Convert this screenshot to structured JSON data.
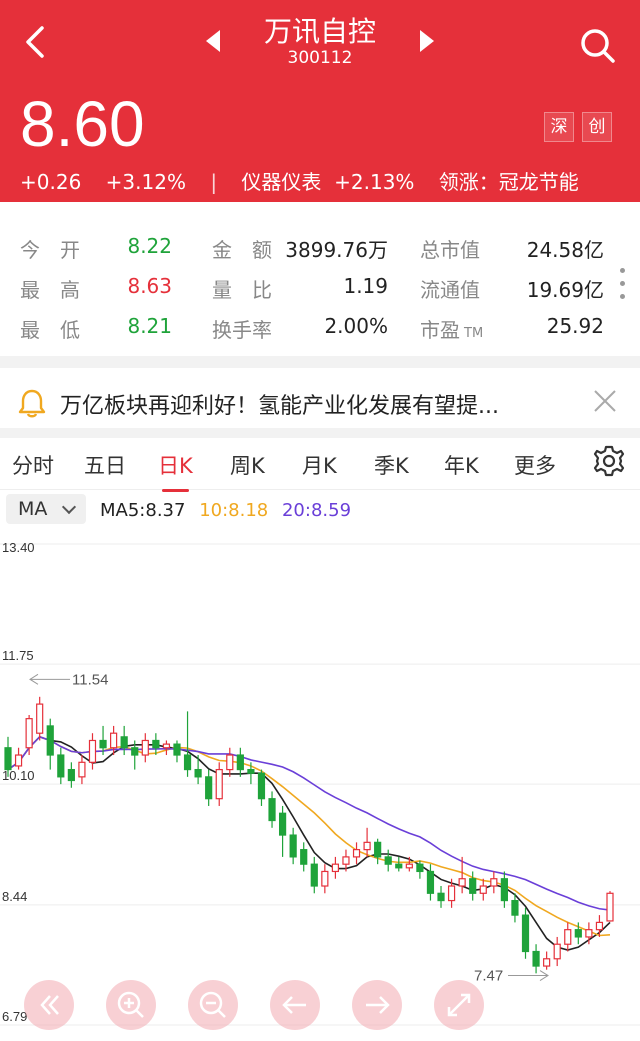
{
  "header": {
    "title": "万讯自控",
    "code": "300112",
    "price": "8.60",
    "change": "+0.26",
    "change_pct": "+3.12%",
    "separator": "|",
    "sector": "仪器仪表",
    "sector_change": "+2.13%",
    "leader": "领涨：冠龙节能",
    "tag_exchange": "深",
    "tag_board": "创"
  },
  "stats": {
    "open_label": "今　开",
    "open": "8.22",
    "high_label": "最　高",
    "high": "8.63",
    "low_label": "最　低",
    "low": "8.21",
    "amount_label": "金　额",
    "amount": "3899.76万",
    "volume_ratio_label": "量　比",
    "volume_ratio": "1.19",
    "turnover_label": "换手率",
    "turnover": "2.00%",
    "market_cap_label": "总市值",
    "market_cap": "24.58亿",
    "float_cap_label": "流通值",
    "float_cap": "19.69亿",
    "pe_label": "市盈",
    "pe_suffix": "TM",
    "pe": "25.92"
  },
  "news": {
    "text": "万亿板块再迎利好！氢能产业化发展有望提..."
  },
  "tabs": [
    {
      "label": "分时"
    },
    {
      "label": "五日"
    },
    {
      "label": "日K"
    },
    {
      "label": "周K"
    },
    {
      "label": "月K"
    },
    {
      "label": "季K"
    },
    {
      "label": "年K"
    },
    {
      "label": "更多"
    }
  ],
  "ma": {
    "selector": "MA",
    "ma5": "MA5:8.37",
    "ma10": "10:8.18",
    "ma20": "20:8.59"
  },
  "colors": {
    "up": "#e5303a",
    "down": "#1fa33a",
    "ma5": "#222222",
    "ma10": "#f0a820",
    "ma20": "#6a3fd8",
    "header_bg": "#e5303a"
  },
  "chart_data": {
    "type": "candlestick",
    "y_ticks": [
      "13.40",
      "11.75",
      "10.10",
      "8.44",
      "6.79"
    ],
    "ylim": [
      6.79,
      13.4
    ],
    "high_marker": "11.54",
    "low_marker": "7.47",
    "candles": [
      [
        10.6,
        10.3,
        10.75,
        10.2
      ],
      [
        10.35,
        10.5,
        10.6,
        10.3
      ],
      [
        10.6,
        11.0,
        11.05,
        10.5
      ],
      [
        10.8,
        11.2,
        11.3,
        10.7
      ],
      [
        10.9,
        10.5,
        11.0,
        10.3
      ],
      [
        10.5,
        10.2,
        10.6,
        10.1
      ],
      [
        10.3,
        10.15,
        10.4,
        10.05
      ],
      [
        10.2,
        10.4,
        10.5,
        10.1
      ],
      [
        10.4,
        10.7,
        10.8,
        10.3
      ],
      [
        10.7,
        10.6,
        10.9,
        10.5
      ],
      [
        10.6,
        10.8,
        10.9,
        10.5
      ],
      [
        10.75,
        10.6,
        10.9,
        10.5
      ],
      [
        10.6,
        10.5,
        10.7,
        10.3
      ],
      [
        10.5,
        10.7,
        10.8,
        10.4
      ],
      [
        10.7,
        10.6,
        10.8,
        10.5
      ],
      [
        10.6,
        10.65,
        10.7,
        10.5
      ],
      [
        10.65,
        10.5,
        10.7,
        10.4
      ],
      [
        10.5,
        10.3,
        11.1,
        10.2
      ],
      [
        10.3,
        10.2,
        10.5,
        10.1
      ],
      [
        10.2,
        9.9,
        10.3,
        9.8
      ],
      [
        9.9,
        10.3,
        10.4,
        9.8
      ],
      [
        10.3,
        10.5,
        10.6,
        10.2
      ],
      [
        10.5,
        10.3,
        10.6,
        10.2
      ],
      [
        10.3,
        10.25,
        10.4,
        10.1
      ],
      [
        10.25,
        9.9,
        10.3,
        9.8
      ],
      [
        9.9,
        9.6,
        10.0,
        9.5
      ],
      [
        9.7,
        9.4,
        9.8,
        9.1
      ],
      [
        9.4,
        9.1,
        9.5,
        9.0
      ],
      [
        9.2,
        9.0,
        9.3,
        8.9
      ],
      [
        9.0,
        8.7,
        9.1,
        8.6
      ],
      [
        8.7,
        8.9,
        9.0,
        8.6
      ],
      [
        8.9,
        9.0,
        9.1,
        8.8
      ],
      [
        9.0,
        9.1,
        9.2,
        8.9
      ],
      [
        9.1,
        9.2,
        9.3,
        9.0
      ],
      [
        9.2,
        9.3,
        9.5,
        9.1
      ],
      [
        9.3,
        9.1,
        9.35,
        9.0
      ],
      [
        9.1,
        9.0,
        9.2,
        8.9
      ],
      [
        9.0,
        8.95,
        9.1,
        8.9
      ],
      [
        8.95,
        9.0,
        9.1,
        8.9
      ],
      [
        9.0,
        8.9,
        9.05,
        8.8
      ],
      [
        8.9,
        8.6,
        9.0,
        8.5
      ],
      [
        8.6,
        8.5,
        8.7,
        8.4
      ],
      [
        8.5,
        8.7,
        8.8,
        8.4
      ],
      [
        8.7,
        8.8,
        9.1,
        8.6
      ],
      [
        8.8,
        8.6,
        8.9,
        8.5
      ],
      [
        8.6,
        8.7,
        8.8,
        8.5
      ],
      [
        8.7,
        8.8,
        8.9,
        8.6
      ],
      [
        8.8,
        8.5,
        8.9,
        8.4
      ],
      [
        8.5,
        8.3,
        8.6,
        8.2
      ],
      [
        8.3,
        7.8,
        8.4,
        7.7
      ],
      [
        7.8,
        7.6,
        7.9,
        7.5
      ],
      [
        7.6,
        7.7,
        7.8,
        7.55
      ],
      [
        7.7,
        7.9,
        8.0,
        7.6
      ],
      [
        7.9,
        8.1,
        8.2,
        7.8
      ],
      [
        8.1,
        8.0,
        8.2,
        7.9
      ],
      [
        8.0,
        8.1,
        8.2,
        7.9
      ],
      [
        8.1,
        8.2,
        8.3,
        8.0
      ],
      [
        8.22,
        8.6,
        8.63,
        8.21
      ]
    ]
  },
  "controls": {
    "first": "first-page-icon",
    "zoom_in": "zoom-in-icon",
    "zoom_out": "zoom-out-icon",
    "prev": "arrow-left-icon",
    "next": "arrow-right-icon",
    "fullscreen": "fullscreen-icon"
  }
}
